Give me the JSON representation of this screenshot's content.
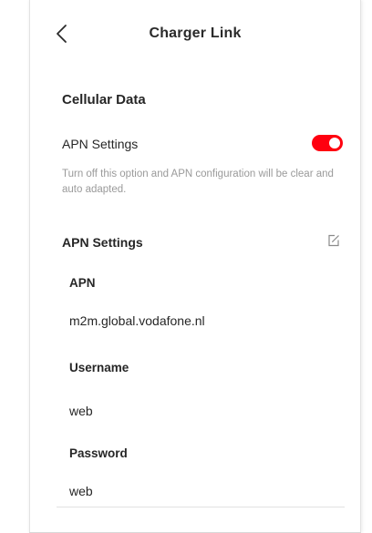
{
  "header": {
    "title": "Charger Link"
  },
  "cellular": {
    "section_title": "Cellular Data",
    "apn_toggle_label": "APN Settings",
    "apn_toggle_on": true,
    "helper_text": "Turn off this option and APN configuration will be clear and auto adapted."
  },
  "apn": {
    "header_label": "APN Settings",
    "fields": [
      {
        "label": "APN",
        "value": "m2m.global.vodafone.nl"
      },
      {
        "label": "Username",
        "value": "web"
      },
      {
        "label": "Password",
        "value": "web"
      }
    ]
  },
  "colors": {
    "toggle_on": "#ff000f",
    "helper_text": "#9a9a9a",
    "text": "#262626"
  }
}
